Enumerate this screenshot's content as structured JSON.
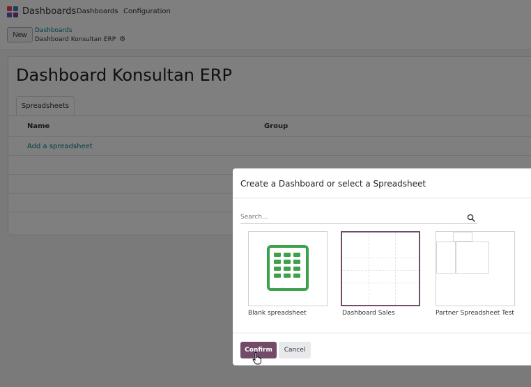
{
  "navbar": {
    "app_name": "Dashboards",
    "menu": [
      "Dashboards",
      "Configuration"
    ]
  },
  "control_panel": {
    "new_label": "New",
    "breadcrumb_parent": "Dashboards",
    "breadcrumb_current": "Dashboard Konsultan ERP"
  },
  "form": {
    "title": "Dashboard Konsultan ERP",
    "tab_label": "Spreadsheets",
    "columns": [
      "Name",
      "Group"
    ],
    "add_link": "Add a spreadsheet"
  },
  "modal": {
    "title": "Create a Dashboard or select a Spreadsheet",
    "search_placeholder": "Search...",
    "cards": [
      {
        "label": "Blank spreadsheet",
        "selected": false
      },
      {
        "label": "Dashboard Sales",
        "selected": true
      },
      {
        "label": "Partner Spreadsheet Test",
        "selected": false
      }
    ],
    "confirm_label": "Confirm",
    "cancel_label": "Cancel"
  },
  "colors": {
    "brand": "#714b67",
    "link": "#017e84",
    "spreadsheet_green": "#3da14b"
  },
  "icons": [
    "app-logo-icon",
    "gear-icon",
    "search-icon",
    "spreadsheet-icon",
    "pointer-cursor-icon"
  ]
}
